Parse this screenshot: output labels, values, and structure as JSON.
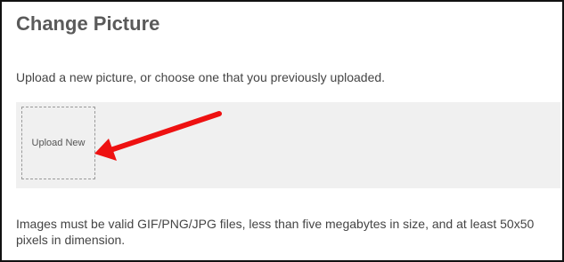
{
  "page": {
    "title": "Change Picture",
    "intro": "Upload a new picture, or choose one that you previously uploaded."
  },
  "gallery": {
    "upload_label": "Upload New"
  },
  "annotation": {
    "arrow_icon": "red-arrow-icon",
    "arrow_color": "#ee1111"
  },
  "footer": {
    "requirements": "Images must be valid GIF/PNG/JPG files, less than five megabytes in size, and at least 50x50 pixels in dimension."
  },
  "colors": {
    "title_text": "#5a5a5a",
    "body_text": "#444444",
    "gallery_bg": "#f0f0f0",
    "border": "#111111"
  }
}
